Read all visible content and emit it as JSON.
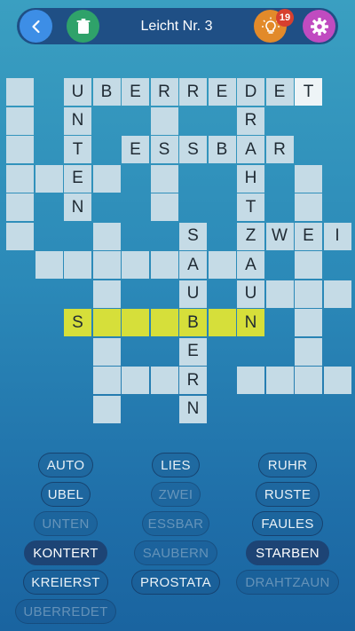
{
  "header": {
    "title": "Leicht Nr. 3",
    "hint_count": "19"
  },
  "grid": [
    {
      "r": 0,
      "c": 0,
      "l": ""
    },
    {
      "r": 0,
      "c": 2,
      "l": "U"
    },
    {
      "r": 0,
      "c": 3,
      "l": "B"
    },
    {
      "r": 0,
      "c": 4,
      "l": "E"
    },
    {
      "r": 0,
      "c": 5,
      "l": "R"
    },
    {
      "r": 0,
      "c": 6,
      "l": "R"
    },
    {
      "r": 0,
      "c": 7,
      "l": "E"
    },
    {
      "r": 0,
      "c": 8,
      "l": "D"
    },
    {
      "r": 0,
      "c": 9,
      "l": "E"
    },
    {
      "r": 0,
      "c": 10,
      "l": "T",
      "s": "cur"
    },
    {
      "r": 1,
      "c": 0,
      "l": ""
    },
    {
      "r": 1,
      "c": 2,
      "l": "N"
    },
    {
      "r": 1,
      "c": 5,
      "l": ""
    },
    {
      "r": 1,
      "c": 8,
      "l": "R"
    },
    {
      "r": 2,
      "c": 0,
      "l": ""
    },
    {
      "r": 2,
      "c": 2,
      "l": "T"
    },
    {
      "r": 2,
      "c": 4,
      "l": "E"
    },
    {
      "r": 2,
      "c": 5,
      "l": "S"
    },
    {
      "r": 2,
      "c": 6,
      "l": "S"
    },
    {
      "r": 2,
      "c": 7,
      "l": "B"
    },
    {
      "r": 2,
      "c": 8,
      "l": "A"
    },
    {
      "r": 2,
      "c": 9,
      "l": "R"
    },
    {
      "r": 3,
      "c": 0,
      "l": ""
    },
    {
      "r": 3,
      "c": 1,
      "l": ""
    },
    {
      "r": 3,
      "c": 2,
      "l": "E"
    },
    {
      "r": 3,
      "c": 3,
      "l": ""
    },
    {
      "r": 3,
      "c": 5,
      "l": ""
    },
    {
      "r": 3,
      "c": 8,
      "l": "H"
    },
    {
      "r": 3,
      "c": 10,
      "l": ""
    },
    {
      "r": 4,
      "c": 0,
      "l": ""
    },
    {
      "r": 4,
      "c": 2,
      "l": "N"
    },
    {
      "r": 4,
      "c": 5,
      "l": ""
    },
    {
      "r": 4,
      "c": 8,
      "l": "T"
    },
    {
      "r": 4,
      "c": 10,
      "l": ""
    },
    {
      "r": 5,
      "c": 0,
      "l": ""
    },
    {
      "r": 5,
      "c": 3,
      "l": ""
    },
    {
      "r": 5,
      "c": 6,
      "l": "S"
    },
    {
      "r": 5,
      "c": 8,
      "l": "Z"
    },
    {
      "r": 5,
      "c": 9,
      "l": "W"
    },
    {
      "r": 5,
      "c": 10,
      "l": "E"
    },
    {
      "r": 5,
      "c": 11,
      "l": "I"
    },
    {
      "r": 6,
      "c": 1,
      "l": ""
    },
    {
      "r": 6,
      "c": 2,
      "l": ""
    },
    {
      "r": 6,
      "c": 3,
      "l": ""
    },
    {
      "r": 6,
      "c": 4,
      "l": ""
    },
    {
      "r": 6,
      "c": 5,
      "l": ""
    },
    {
      "r": 6,
      "c": 6,
      "l": "A"
    },
    {
      "r": 6,
      "c": 7,
      "l": ""
    },
    {
      "r": 6,
      "c": 8,
      "l": "A"
    },
    {
      "r": 6,
      "c": 10,
      "l": ""
    },
    {
      "r": 7,
      "c": 3,
      "l": ""
    },
    {
      "r": 7,
      "c": 6,
      "l": "U"
    },
    {
      "r": 7,
      "c": 8,
      "l": "U"
    },
    {
      "r": 7,
      "c": 9,
      "l": ""
    },
    {
      "r": 7,
      "c": 10,
      "l": ""
    },
    {
      "r": 7,
      "c": 11,
      "l": ""
    },
    {
      "r": 8,
      "c": 2,
      "l": "S",
      "s": "hl"
    },
    {
      "r": 8,
      "c": 3,
      "l": "",
      "s": "hl"
    },
    {
      "r": 8,
      "c": 4,
      "l": "",
      "s": "hl"
    },
    {
      "r": 8,
      "c": 5,
      "l": "",
      "s": "hl"
    },
    {
      "r": 8,
      "c": 6,
      "l": "B",
      "s": "hl"
    },
    {
      "r": 8,
      "c": 7,
      "l": "",
      "s": "hl"
    },
    {
      "r": 8,
      "c": 8,
      "l": "N",
      "s": "hl"
    },
    {
      "r": 8,
      "c": 10,
      "l": ""
    },
    {
      "r": 9,
      "c": 3,
      "l": ""
    },
    {
      "r": 9,
      "c": 6,
      "l": "E"
    },
    {
      "r": 9,
      "c": 10,
      "l": ""
    },
    {
      "r": 10,
      "c": 3,
      "l": ""
    },
    {
      "r": 10,
      "c": 4,
      "l": ""
    },
    {
      "r": 10,
      "c": 5,
      "l": ""
    },
    {
      "r": 10,
      "c": 6,
      "l": "R"
    },
    {
      "r": 10,
      "c": 8,
      "l": ""
    },
    {
      "r": 10,
      "c": 9,
      "l": ""
    },
    {
      "r": 10,
      "c": 10,
      "l": ""
    },
    {
      "r": 10,
      "c": 11,
      "l": ""
    },
    {
      "r": 11,
      "c": 3,
      "l": ""
    },
    {
      "r": 11,
      "c": 6,
      "l": "N"
    }
  ],
  "words": [
    {
      "label": "AUTO",
      "state": "open"
    },
    {
      "label": "LIES",
      "state": "open"
    },
    {
      "label": "RUHR",
      "state": "open"
    },
    {
      "label": "UBEL",
      "state": "open"
    },
    {
      "label": "ZWEI",
      "state": "used"
    },
    {
      "label": "RUSTE",
      "state": "open"
    },
    {
      "label": "UNTEN",
      "state": "used"
    },
    {
      "label": "ESSBAR",
      "state": "used"
    },
    {
      "label": "FAULES",
      "state": "open"
    },
    {
      "label": "KONTERT",
      "state": "done"
    },
    {
      "label": "SAUBERN",
      "state": "used"
    },
    {
      "label": "STARBEN",
      "state": "done"
    },
    {
      "label": "KREIERST",
      "state": "open"
    },
    {
      "label": "PROSTATA",
      "state": "open"
    },
    {
      "label": "DRAHTZAUN",
      "state": "used"
    },
    {
      "label": "UBERREDET",
      "state": "used"
    }
  ]
}
